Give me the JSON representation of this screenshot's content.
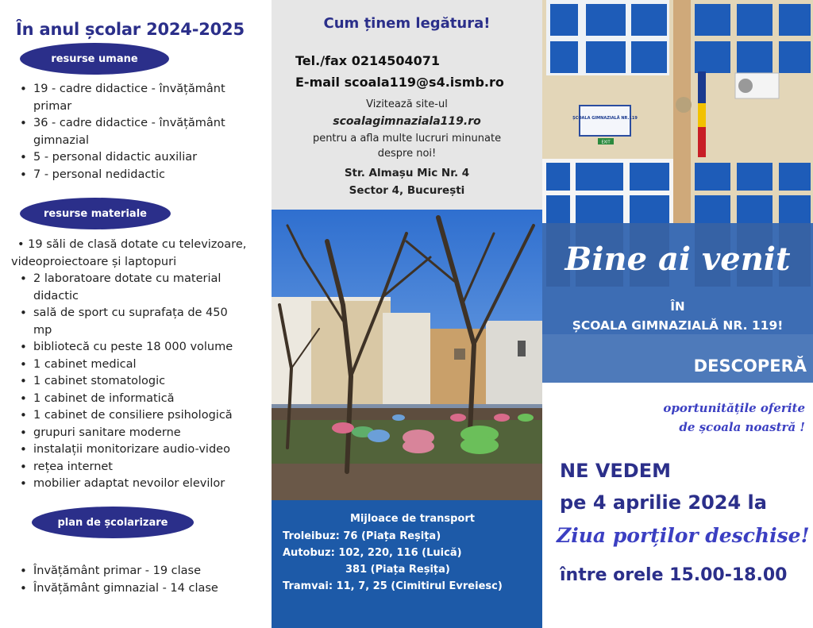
{
  "left": {
    "title": "În anul școlar 2024-2025",
    "human_resources": {
      "label": "resurse umane",
      "items": [
        "19 - cadre didactice - învățământ",
        "primar",
        "36 - cadre didactice - învățământ",
        "gimnazial",
        "5 - personal didactic auxiliar",
        "7 - personal nedidactic"
      ]
    },
    "material_resources": {
      "label": "resurse materiale",
      "first_line": "19 săli de clasă dotate cu televizoare,",
      "first_line_cont": "videoproiectoare și laptopuri",
      "items": [
        "2 laboratoare dotate cu material",
        "didactic",
        "sală de sport cu suprafața de 450",
        "mp",
        "bibliotecă cu peste 18 000 volume",
        "1 cabinet medical",
        "1 cabinet stomatologic",
        "1 cabinet de informatică",
        "1 cabinet de consiliere psihologică",
        "grupuri sanitare moderne",
        "instalații monitorizare audio-video",
        "rețea internet",
        "mobilier adaptat nevoilor elevilor"
      ]
    },
    "schooling_plan": {
      "label": "plan de școlarizare",
      "items": [
        "Învățământ primar - 19 clase",
        "Învățământ gimnazial - 14 clase"
      ]
    }
  },
  "middle": {
    "heading": "Cum ținem legătura!",
    "phone": "Tel./fax 0214504071",
    "email": "E-mail scoala119@s4.ismb.ro",
    "visit": "Vizitează  site-ul",
    "website": "scoalagimnaziala119.ro",
    "visit_tail_1": "pentru a afla multe lucruri minunate",
    "visit_tail_2": "despre noi!",
    "address_1": "Str. Almașu Mic Nr. 4",
    "address_2": "Sector 4, București",
    "transport": {
      "title": "Mijloace de transport",
      "trolley": "Troleibuz: 76 (Piața Reșița)",
      "bus": "Autobuz: 102, 220, 116 (Luică)",
      "bus_2": "381 (Piața Reșița)",
      "tram": "Tramvai: 11, 7, 25 (Cimitirul Evreiesc)"
    }
  },
  "right": {
    "welcome": "Bine ai venit",
    "in": "ÎN",
    "school": "ȘCOALA GIMNAZIALĂ NR. 119!",
    "discover": "DESCOPERĂ",
    "opportunities_1": "oportunitățile oferite",
    "opportunities_2": "de școala noastră !",
    "see_you": "NE VEDEM",
    "date": "pe 4 aprilie 2024 la",
    "open_day": "Ziua porților deschise!",
    "hours": "între orele 15.00-18.00",
    "school_sign": "ȘCOALA GIMNAZIALĂ NR.119",
    "exit_sign": "EXIT"
  },
  "colors": {
    "navy": "#2b2f8a",
    "transport_blue": "#1d5aa8",
    "welcome_blue": "#3d6db4",
    "script_blue": "#3b3fc2",
    "panel_grey": "#e6e6e6"
  }
}
